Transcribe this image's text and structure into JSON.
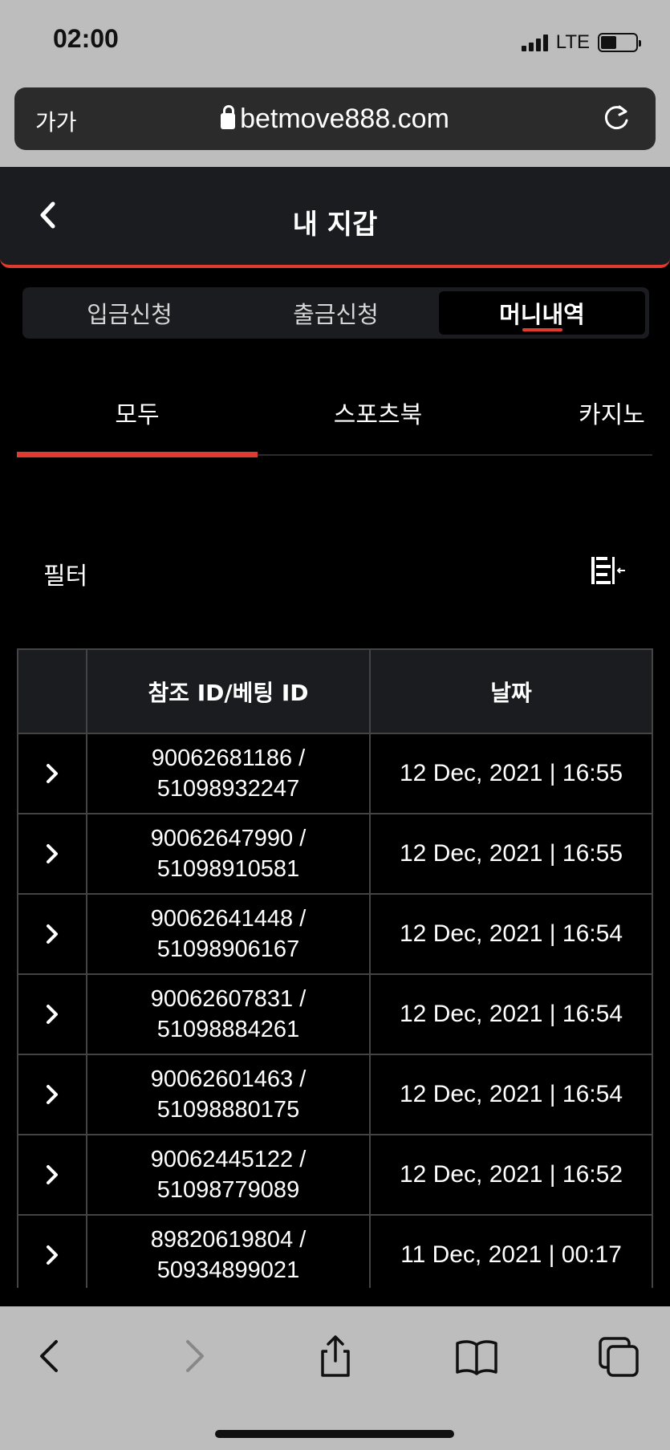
{
  "status_bar": {
    "time": "02:00",
    "network": "LTE",
    "battery_level": 0.45
  },
  "browser": {
    "text_size_label": "가가",
    "url": "betmove888.com",
    "icons": [
      "lock-icon",
      "reload-icon"
    ]
  },
  "header": {
    "title": "내 지갑",
    "back_icon": "chevron-left-icon"
  },
  "segment_tabs": [
    {
      "label": "입금신청",
      "active": false
    },
    {
      "label": "출금신청",
      "active": false
    },
    {
      "label": "머니내역",
      "active": true
    }
  ],
  "sub_tabs": [
    {
      "label": "모두",
      "active": true
    },
    {
      "label": "스포츠북",
      "active": false
    },
    {
      "label": "카지노",
      "active": false
    }
  ],
  "filter": {
    "label": "필터",
    "icon": "filter-collapse-icon"
  },
  "table": {
    "headers": [
      "",
      "참조 ID/베팅 ID",
      "날짜"
    ],
    "rows": [
      {
        "ref_id": "90062681186 /",
        "bet_id": "51098932247",
        "date": "12 Dec, 2021 | 16:55"
      },
      {
        "ref_id": "90062647990 /",
        "bet_id": "51098910581",
        "date": "12 Dec, 2021 | 16:55"
      },
      {
        "ref_id": "90062641448 /",
        "bet_id": "51098906167",
        "date": "12 Dec, 2021 | 16:54"
      },
      {
        "ref_id": "90062607831 /",
        "bet_id": "51098884261",
        "date": "12 Dec, 2021 | 16:54"
      },
      {
        "ref_id": "90062601463 /",
        "bet_id": "51098880175",
        "date": "12 Dec, 2021 | 16:54"
      },
      {
        "ref_id": "90062445122 /",
        "bet_id": "51098779089",
        "date": "12 Dec, 2021 | 16:52"
      },
      {
        "ref_id": "89820619804 /",
        "bet_id": "50934899021",
        "date": "11 Dec, 2021 | 00:17"
      }
    ]
  },
  "toolbar": {
    "icons": [
      "back-icon",
      "forward-icon",
      "share-icon",
      "bookmarks-icon",
      "tabs-icon"
    ]
  },
  "colors": {
    "accent": "#e13a2e",
    "header_bg": "#1b1c1f",
    "background": "#000000",
    "browser_chrome": "#bdbdbd"
  }
}
